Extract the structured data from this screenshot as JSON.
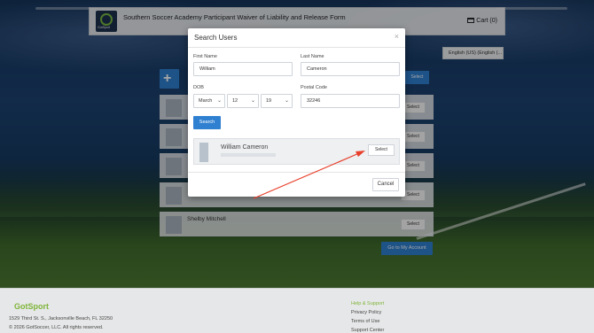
{
  "header": {
    "title": "Southern Soccer Academy Participant Waiver of Liability and Release Form",
    "logo_text": "GotSport",
    "cart_label": "Cart (0)"
  },
  "language": {
    "selected": "English (US) (English (..."
  },
  "participants": {
    "add_icon": "plus-icon",
    "bg_select_label": "Select",
    "rows": [
      {
        "name": "",
        "select_label": "Select"
      },
      {
        "name": "",
        "select_label": "Select"
      },
      {
        "name": "",
        "select_label": "Select"
      },
      {
        "name": "",
        "select_label": "Select"
      },
      {
        "name": "Shelby Mitchell",
        "select_label": "Select"
      }
    ],
    "go_to_account_label": "Go to My Account"
  },
  "modal": {
    "title": "Search Users",
    "close_glyph": "×",
    "first_name_label": "First Name",
    "first_name_value": "William",
    "last_name_label": "Last Name",
    "last_name_value": "Cameron",
    "dob_label": "DOB",
    "dob_month": "March",
    "dob_day": "12",
    "dob_year": "19",
    "postal_label": "Postal Code",
    "postal_value": "32246",
    "search_label": "Search",
    "result": {
      "name": "William Cameron",
      "select_label": "Select"
    },
    "cancel_label": "Cancel"
  },
  "annotation": {
    "arrow_color": "#e8402c"
  },
  "footer": {
    "brand": "GotSport",
    "address": "1529 Third St. S., Jacksonville Beach, FL 32250",
    "copyright": "© 2026 GotSoccer, LLC. All rights reserved.",
    "links_heading": "Help & Support",
    "links": [
      "Privacy Policy",
      "Terms of Use",
      "Support Center"
    ]
  },
  "colors": {
    "primary": "#2f80d1",
    "brand_green": "#7fb53a"
  }
}
